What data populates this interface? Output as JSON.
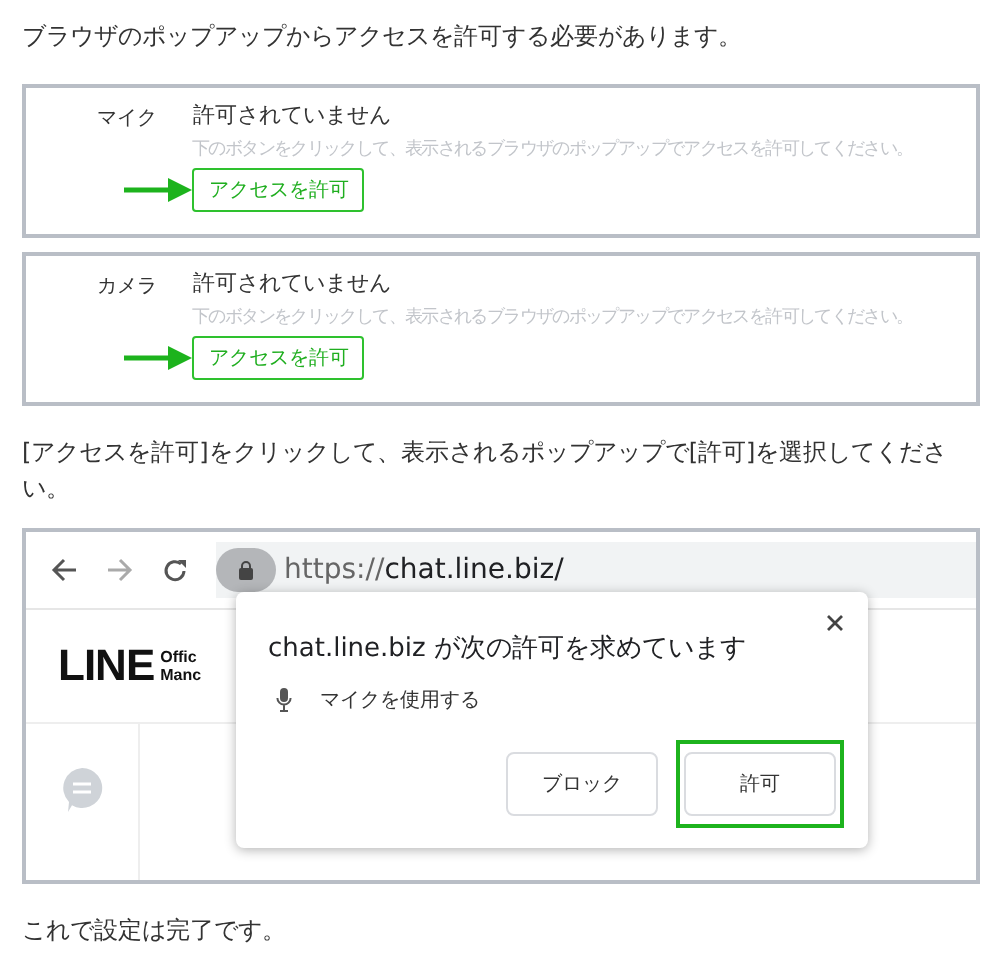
{
  "intro": "ブラウザのポップアップからアクセスを許可する必要があります。",
  "permissions": [
    {
      "label": "マイク",
      "status": "許可されていません",
      "hint": "下のボタンをクリックして、表示されるブラウザのポップアップでアクセスを許可してください。",
      "button": "アクセスを許可"
    },
    {
      "label": "カメラ",
      "status": "許可されていません",
      "hint": "下のボタンをクリックして、表示されるブラウザのポップアップでアクセスを許可してください。",
      "button": "アクセスを許可"
    }
  ],
  "instruction": "[アクセスを許可]をクリックして、表示されるポップアップで[許可]を選択してください。",
  "browser": {
    "url_scheme": "https://",
    "url_host": "chat.line.biz/",
    "logo": "LINE",
    "logo_sub": [
      "Offic",
      "Manc"
    ],
    "popup": {
      "title": "chat.line.biz が次の許可を求めています",
      "permission": "マイクを使用する",
      "buttons": [
        {
          "label": "ブロック",
          "highlighted": false
        },
        {
          "label": "許可",
          "highlighted": true
        }
      ]
    }
  },
  "outro": "これで設定は完了です。"
}
